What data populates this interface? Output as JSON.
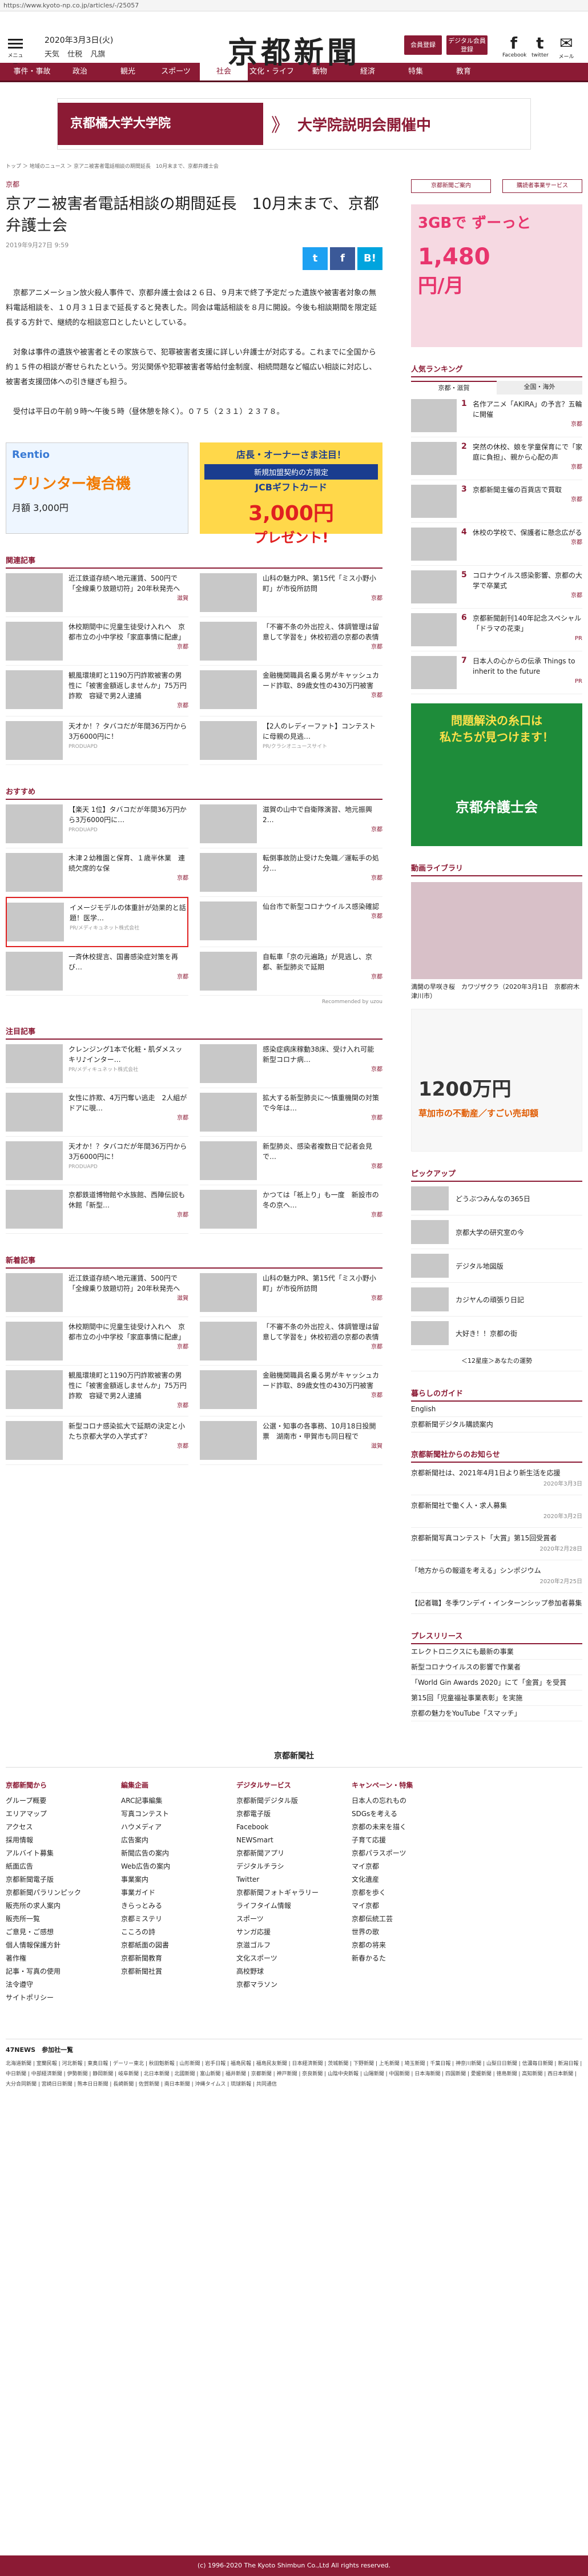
{
  "browser": {
    "url": "https://www.kyoto-np.co.jp/articles/-/25057"
  },
  "header": {
    "menu_label": "メニュー",
    "date": "2020年3月3日(火)",
    "weather": [
      "天気",
      "仕税",
      "凡旗"
    ],
    "logo": "京都新聞",
    "login": "会員登録",
    "digital": "デジタル会員登録",
    "sns": [
      {
        "icon": "f",
        "label": "Facebook"
      },
      {
        "icon": "t",
        "label": "twitter"
      },
      {
        "icon": "✉",
        "label": "メール"
      }
    ]
  },
  "nav": [
    "事件・事故",
    "政治",
    "観光",
    "スポーツ",
    "社会",
    "文化・ライフ",
    "動物",
    "経済",
    "特集",
    "教育"
  ],
  "banner": {
    "left": "京都橘大学大学院",
    "arrow": "》",
    "right": "大学院説明会開催中"
  },
  "breadcrumbs": "トップ ＞ 地域のニュース ＞ 京アニ被害者電話相談の期間延長　10月末まで、京都弁護士会",
  "article": {
    "category": "京都",
    "title": "京アニ被害者電話相談の期間延長　10月末まで、京都弁護士会",
    "date": "2019年9月27日 9:59",
    "share": [
      "t",
      "f",
      "B!"
    ],
    "paragraphs": [
      "京都アニメーション放火殺人事件で、京都弁護士会は２６日、９月末で終了予定だった遺族や被害者対象の無料電話相談を、１０月３１日まで延長すると発表した。同会は電話相談を８月に開設。今後も相談期間を限定延長する方針で、継続的な相談窓口としたいとしている。",
      "対象は事件の遺族や被害者とその家族らで、犯罪被害者支援に詳しい弁護士が対応する。これまでに全国から約１５件の相談が寄せられたという。労災関係や犯罪被害者等給付金制度、相続問題など幅広い相談に対応し、被害者支援団体への引き継ぎも担う。",
      "受付は平日の午前９時〜午後５時（昼休憩を除く）。０７５（２３１）２３７８。"
    ]
  },
  "ads": {
    "rentio": {
      "brand": "Rentio",
      "head": "プリンター複合機",
      "price": "月額 3,000円"
    },
    "jcb": {
      "head": "店長・オーナーさま注目！",
      "sub": "新規加盟契約の方限定",
      "gift": "JCBギフトカード",
      "amount": "3,000円",
      "cta": "プレゼント!"
    },
    "uq": {
      "line1": "3GBで ずーっと",
      "price": "1,480",
      "unit": "円/月"
    },
    "bengoshi": {
      "line1": "問題解決の糸口は",
      "line2": "私たちが見つけます！",
      "name": "京都弁護士会"
    },
    "realestate": {
      "title": "1200万円",
      "sub": "草加市の不動産／すごい売却額"
    }
  },
  "sections": {
    "related": {
      "title": "関連記事",
      "items": [
        {
          "text": "近江鉄道存続へ地元運賃、500円で「全線乗り放題切符」20年秋発売へ",
          "tag": "滋賀"
        },
        {
          "text": "山科の魅力PR、第15代「ミス小野小町」が市役所訪問",
          "tag": "京都"
        },
        {
          "text": "休校期間中に児童生徒受け入れへ　京都市立の小中学校「家庭事情に配慮」",
          "tag": "京都"
        },
        {
          "text": "「不審不条の外出控え、体調管理は留意して学習を」休校初週の京都の表情",
          "tag": "京都"
        },
        {
          "text": "観風環境町と1190万円詐欺被害の男性に「被害金額返しませんか」75万円詐欺　容疑で男2人逮捕",
          "tag": "京都"
        },
        {
          "text": "金融機関職員名乗る男がキャッシュカード詐取、89歳女性の430万円被害",
          "tag": "京都"
        },
        {
          "text": "天才か！？タバコだが年間36万円から3万6000円に！",
          "tag": "",
          "pr": "PRODUAPD"
        },
        {
          "text": "【2人のレディーファト】コンテストに母親の見逃…",
          "tag": "",
          "pr": "PR/クラシオニュースサイト"
        }
      ]
    },
    "recommended": {
      "title": "おすすめ",
      "items": [
        {
          "text": "【楽天 1位】タバコだが年間36万円から3万6000円に…",
          "tag": "",
          "pr": "PRODUAPD"
        },
        {
          "text": "滋賀の山中で自衛隊演習、地元振興2…",
          "tag": "京都"
        },
        {
          "text": "木津２幼稚園と保育、１歳半休業　連続欠席的な保",
          "tag": "京都"
        },
        {
          "text": "転倒事故防止受けた免職／運転手の処分…",
          "tag": "京都"
        },
        {
          "text": "イメージモデルの体重計が効果的と話題！医学…",
          "tag": "",
          "pr": "PR/メディキュネット株式会社"
        },
        {
          "text": "仙台市で新型コロナウイルス感染確認",
          "tag": "京都"
        },
        {
          "text": "一斉休校提言、国書感染症対策を再び…",
          "tag": "京都"
        },
        {
          "text": "自転車「京の元遍路」が見逃し、京都、新型肺炎で延期",
          "tag": "京都"
        }
      ],
      "provided_by": "Recommended by uzou"
    },
    "featured": {
      "title": "注目記事",
      "items": [
        {
          "text": "クレンジング1本で化粧・肌ダメスッキリ♪インター…",
          "tag": "",
          "pr": "PR/メディキュネット株式会社"
        },
        {
          "text": "感染症病床稼動38床、受け入れ可能　新型コロナ病…",
          "tag": "京都"
        },
        {
          "text": "女性に詐欺、4万円奪い逃走　2人組がドアに覗…",
          "tag": "京都"
        },
        {
          "text": "拡大する新型肺炎に～慎重機関の対策で今年は…",
          "tag": "京都"
        },
        {
          "text": "天才か！？タバコだが年間36万円から3万6000円に！",
          "tag": "",
          "pr": "PRODUAPD"
        },
        {
          "text": "新型肺炎、感染者複数日で記者会見で…",
          "tag": "京都"
        },
        {
          "text": "京都鉄道博物館や水族館、西陣伝説も休館「新型…",
          "tag": "京都"
        },
        {
          "text": "かつては「祇上り」も一度　新設市の冬の京へ…",
          "tag": "京都"
        }
      ]
    },
    "latest": {
      "title": "新着記事",
      "items": [
        {
          "text": "近江鉄道存続へ地元運賃、500円で「全線乗り放題切符」20年秋発売へ",
          "tag": "滋賀"
        },
        {
          "text": "山科の魅力PR、第15代「ミス小野小町」が市役所訪問",
          "tag": "京都"
        },
        {
          "text": "休校期間中に児童生徒受け入れへ　京都市立の小中学校「家庭事情に配慮」",
          "tag": "京都"
        },
        {
          "text": "「不審不条の外出控え、体調管理は留意して学習を」休校初週の京都の表情",
          "tag": "京都"
        },
        {
          "text": "観風環境町と1190万円詐欺被害の男性に「被害金額返しませんか」75万円詐欺　容疑で男2人逮捕",
          "tag": "京都"
        },
        {
          "text": "金融機関職員名乗る男がキャッシュカード詐取、89歳女性の430万円被害",
          "tag": "京都"
        },
        {
          "text": "新型コロナ感染拡大で延期の決定と小たち京都大学の入学式ず？",
          "tag": "京都"
        },
        {
          "text": "公選・知事の各事務、10月18日投開票　湖南市・甲賀市も同日程で",
          "tag": "滋賀"
        }
      ]
    }
  },
  "sidebar": {
    "buttons": [
      "京都新聞ご案内",
      "購読者事業サービス"
    ],
    "ranking": {
      "title": "人気ランキング",
      "tabs": [
        "京都・滋賀",
        "全国・海外"
      ],
      "items": [
        {
          "n": "1",
          "text": "名作アニメ「AKIRA」の予言？五輪に開催",
          "tag": "京都"
        },
        {
          "n": "2",
          "text": "突然の休校、娘を学童保育にで「家庭に負担」、親から心配の声",
          "tag": "京都"
        },
        {
          "n": "3",
          "text": "京都新聞主催の百貨店で買取",
          "tag": "京都"
        },
        {
          "n": "4",
          "text": "休校の学校で、保護者に懸念広がる",
          "tag": "京都"
        },
        {
          "n": "5",
          "text": "コロナウイルス感染影響、京都の大学で卒業式",
          "tag": "京都"
        },
        {
          "n": "6",
          "text": "京都新聞創刊140年記念スペシャル「ドラマの花束」",
          "tag": "PR"
        },
        {
          "n": "7",
          "text": "日本人の心からの伝承 Things to inherit to the future",
          "tag": "PR"
        }
      ]
    },
    "video": {
      "title": "動画ライブラリ",
      "caption": "満開の早咲き桜　カワヅザクラ（2020年3月1日　京都府木津川市）"
    },
    "pickup": {
      "title": "ピックアップ",
      "items": [
        "どうぶつみんなの365日",
        "京都大学の研究室の今",
        "デジタル地図版",
        "カジヤんの頑張り日記",
        "大好き！！京都の街"
      ],
      "more": "＜12星座＞あなたの運勢"
    },
    "guide": {
      "title": "暮らしのガイド",
      "items": [
        "English",
        "京都新聞デジタル購読案内"
      ]
    },
    "news": {
      "title": "京都新聞社からのお知らせ",
      "items": [
        {
          "text": "京都新聞社は、2021年4月1日より新生活を応援",
          "date": "2020年3月3日"
        },
        {
          "text": "京都新聞社で働く人・求人募集",
          "date": "2020年3月2日"
        },
        {
          "text": "京都新聞写真コンテスト「大賞」第15回受賞者",
          "date": "2020年2月28日"
        },
        {
          "text": "「地方からの報道を考える」シンポジウム",
          "date": "2020年2月25日"
        },
        {
          "text": "【記者職】冬季ワンデイ・インターンシップ参加者募集",
          "date": ""
        }
      ]
    },
    "press": {
      "title": "プレスリリース",
      "items": [
        "エレクトロニクスにも最新の事業",
        "新型コロナウイルスの影響で作業者",
        "「World Gin Awards 2020」にて「金賞」を受賞",
        "第15回「児童福祉事業表彰」を実施",
        "京都の魅力をYouTube「スマッチ」"
      ]
    }
  },
  "footer": {
    "corp": "京都新聞社",
    "columns": [
      {
        "head": "京都新聞から",
        "items": [
          "グループ概要",
          "エリアマップ",
          "アクセス",
          "採用情報",
          "アルバイト募集",
          "紙面広告",
          "京都新聞電子版",
          "京都新聞パラリンピック",
          "販売所の求人案内",
          "販売所一覧",
          "ご意見・ご感想",
          "個人情報保護方針",
          "著作権",
          "記事・写真の使用",
          "法令遵守",
          "サイトポリシー"
        ]
      },
      {
        "head": "編集企画",
        "items": [
          "ARC記事編集",
          "写真コンテスト",
          "ハウメディア",
          "広告案内",
          "新聞広告の案内",
          "Web広告の案内",
          "事業案内",
          "事業ガイド",
          "きらっとみる",
          "京都ミステリ",
          "こころの詩",
          "京都紙面の図書",
          "京都新聞教育",
          "京都新聞社賞"
        ]
      },
      {
        "head": "デジタルサービス",
        "items": [
          "京都新聞デジタル版",
          "京都電子版",
          "Facebook",
          "NEWSmart",
          "京都新聞アプリ",
          "デジタルチラシ",
          "Twitter",
          "京都新聞フォトギャラリー",
          "ライフタイム情報",
          "スポーツ",
          "サンガ応援",
          "京滋ゴルフ",
          "文化スポーツ",
          "高校野球",
          "京都マラソン"
        ]
      },
      {
        "head": "キャンペーン・特集",
        "items": [
          "日本人の忘れもの",
          "SDGsを考える",
          "京都の未来を描く",
          "子育て応援",
          "京都パラスポーツ",
          "マイ京都",
          "文化遺産",
          "京都を歩く",
          "マイ京都",
          "京都伝統工芸",
          "世界の歌",
          "京都の将来",
          "新春かるた"
        ]
      },
      {
        "head": "",
        "items": []
      }
    ]
  },
  "newspapers": {
    "title": "47NEWS　参加社一覧",
    "list": "北海道新聞 | 室蘭民報 | 河北新報 | 東奥日報 | デーリー東北 | 秋田魁新報 | 山形新聞 | 岩手日報 | 福島民報 | 福島民友新聞 | 日本経済新聞 | 茨城新聞 | 下野新聞 | 上毛新聞 | 埼玉新聞 | 千葉日報 | 神奈川新聞 | 山梨日日新聞 | 信濃毎日新聞 | 新潟日報 | 中日新聞 | 中部経済新聞 | 伊勢新聞 | 静岡新聞 | 岐阜新聞 | 北日本新聞 | 北國新聞 | 富山新聞 | 福井新聞 | 京都新聞 | 神戸新聞 | 奈良新聞 | 山陰中央新報 | 山陽新聞 | 中国新聞 | 日本海新聞 | 四国新聞 | 愛媛新聞 | 徳島新聞 | 高知新聞 | 西日本新聞 | 大分合同新聞 | 宮崎日日新聞 | 熊本日日新聞 | 長崎新聞 | 佐賀新聞 | 南日本新聞 | 沖縄タイムス | 琉球新報 | 共同通信"
  },
  "copyright": "(c) 1996-2020 The Kyoto Shimbun Co.,Ltd All rights reserved."
}
